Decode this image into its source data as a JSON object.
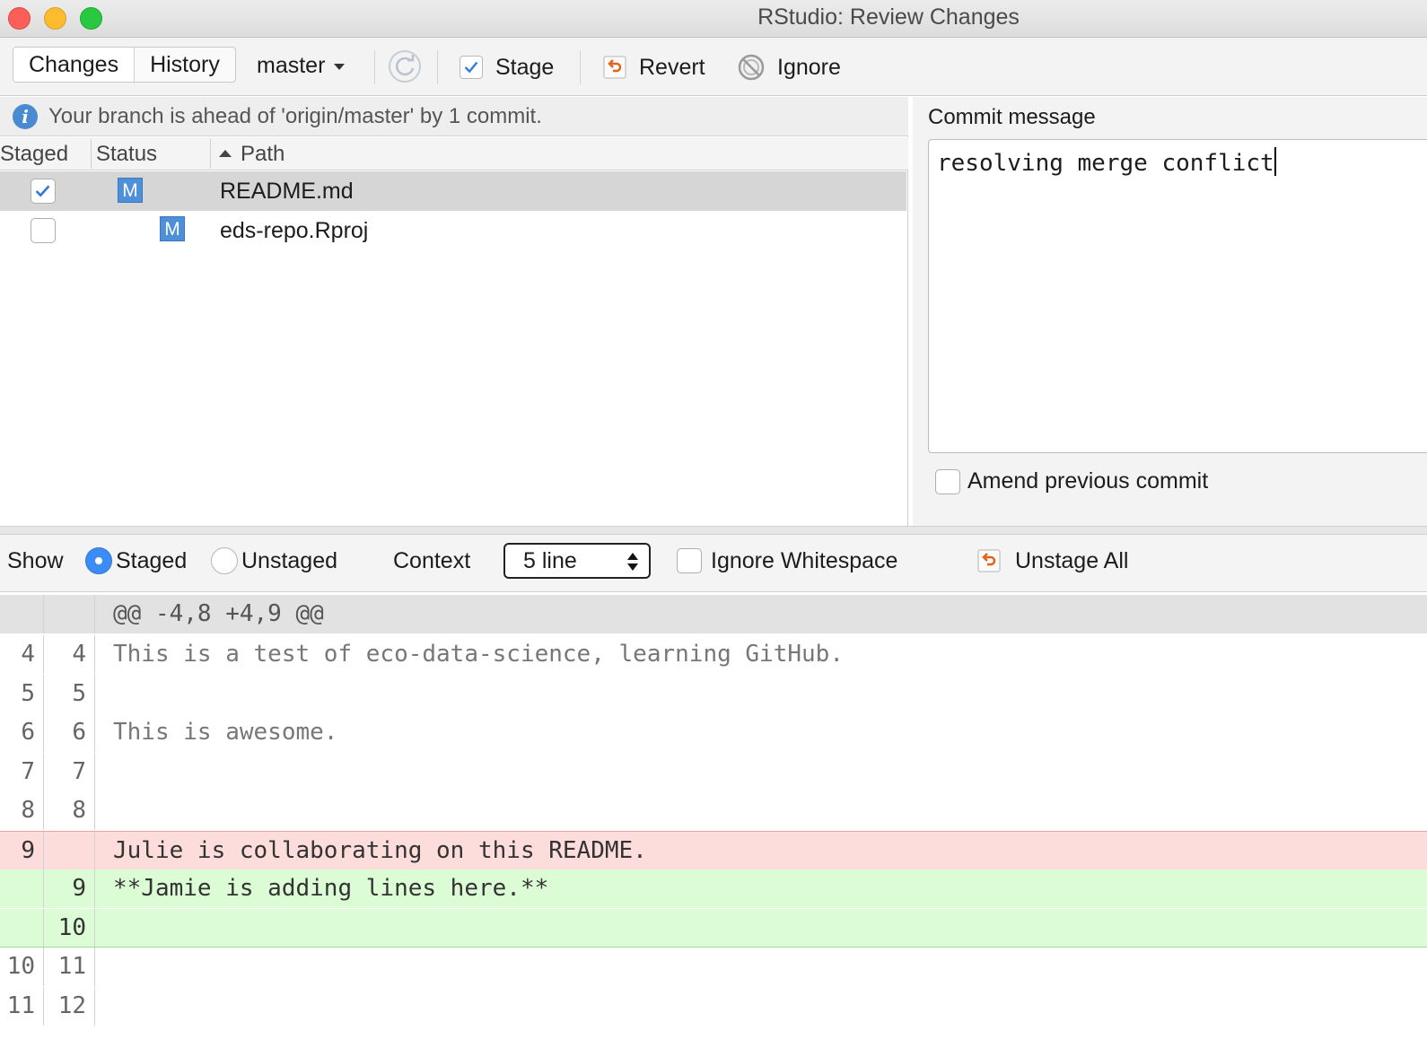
{
  "window": {
    "title": "RStudio: Review Changes"
  },
  "toolbar": {
    "tabs": [
      "Changes",
      "History"
    ],
    "branch": "master",
    "stage_label": "Stage",
    "revert_label": "Revert",
    "ignore_label": "Ignore"
  },
  "info": {
    "message": "Your branch is ahead of 'origin/master' by 1 commit."
  },
  "files_table": {
    "headers": {
      "staged": "Staged",
      "status": "Status",
      "path": "Path"
    },
    "rows": [
      {
        "staged": true,
        "status": "M",
        "path": "README.md",
        "selected": true
      },
      {
        "staged": false,
        "status": "M",
        "path": "eds-repo.Rproj",
        "selected": false
      }
    ]
  },
  "commit": {
    "label": "Commit message",
    "message": "resolving merge conflict",
    "amend_label": "Amend previous commit",
    "amend_checked": false
  },
  "diff_toolbar": {
    "show_label": "Show",
    "staged_label": "Staged",
    "unstaged_label": "Unstaged",
    "selected_view": "Staged",
    "context_label": "Context",
    "context_value": "5 line",
    "ignore_whitespace_label": "Ignore Whitespace",
    "unstage_all_label": "Unstage All"
  },
  "diff": {
    "hunk_header": "@@ -4,8 +4,9 @@",
    "lines": [
      {
        "type": "context",
        "old": "4",
        "new": "4",
        "text": "This is a test of eco-data-science, learning GitHub."
      },
      {
        "type": "context",
        "old": "5",
        "new": "5",
        "text": ""
      },
      {
        "type": "context",
        "old": "6",
        "new": "6",
        "text": "This is awesome."
      },
      {
        "type": "context",
        "old": "7",
        "new": "7",
        "text": ""
      },
      {
        "type": "context",
        "old": "8",
        "new": "8",
        "text": ""
      },
      {
        "type": "deleted",
        "old": "9",
        "new": "",
        "text": "Julie is collaborating on this README."
      },
      {
        "type": "added",
        "old": "",
        "new": "9",
        "text": "**Jamie is adding lines here.**"
      },
      {
        "type": "added",
        "old": "",
        "new": "10",
        "text": ""
      },
      {
        "type": "context",
        "old": "10",
        "new": "11",
        "text": ""
      },
      {
        "type": "context",
        "old": "11",
        "new": "12",
        "text": ""
      }
    ]
  },
  "colors": {
    "deleted_bg": "#fddcdc",
    "added_bg": "#dcfcd6",
    "selected_row_bg": "#d6d6d6",
    "status_badge": "#4d8fd8",
    "accent_blue": "#3b8cf6"
  },
  "icons": {
    "info": "info-icon",
    "refresh": "refresh-icon",
    "stage": "checkbox-check-icon",
    "revert": "revert-arrow-icon",
    "ignore": "prohibited-icon",
    "unstage_all": "revert-arrow-icon"
  }
}
